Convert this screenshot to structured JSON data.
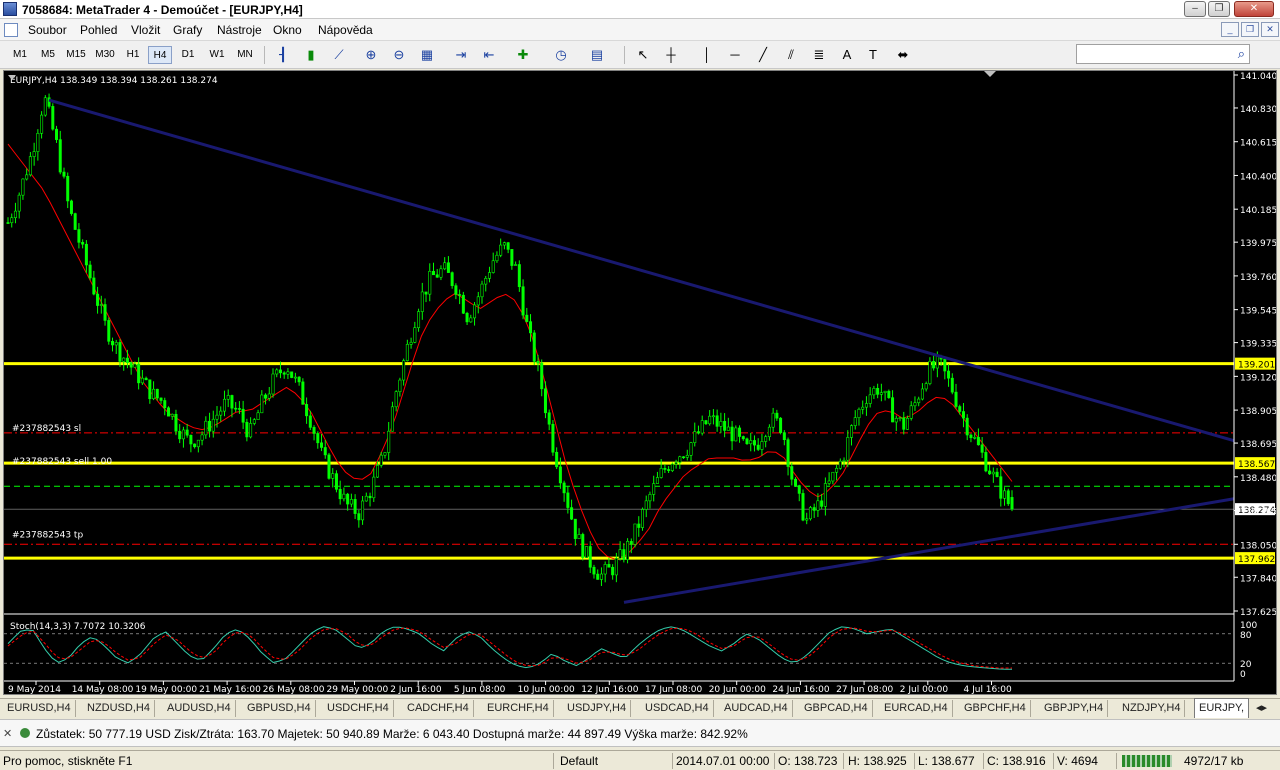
{
  "window": {
    "title": "7058684: MetaTrader 4 - Demoúčet - [EURJPY,H4]"
  },
  "menu": [
    "Soubor",
    "Pohled",
    "Vložit",
    "Grafy",
    "Nástroje",
    "Okno",
    "Nápověda"
  ],
  "toolbar": {
    "timeframes": [
      "M1",
      "M5",
      "M15",
      "M30",
      "H1",
      "H4",
      "D1",
      "W1",
      "MN"
    ],
    "active_timeframe": "H4",
    "search_placeholder": ""
  },
  "chart_header": "EURJPY,H4  138.349 138.394 138.261 138.274",
  "indicator_header": "Stoch(14,3,3) 7.7072 10.3206",
  "order_labels": {
    "sl": "#237882543 sl",
    "sell": "#237882543 sell 1.00",
    "tp": "#237882543 tp"
  },
  "colors": {
    "background": "#000000",
    "candle": "#00ff00",
    "ma": "#ff0000",
    "sr_line": "#ffff00",
    "trendline": "#191970"
  },
  "chart_data": {
    "type": "candlestick",
    "symbol": "EURJPY",
    "timeframe": "H4",
    "ohlc": {
      "open": 138.349,
      "high": 138.394,
      "low": 138.261,
      "close": 138.274
    },
    "y_ticks": [
      "141.040",
      "140.830",
      "140.615",
      "140.400",
      "140.185",
      "139.975",
      "139.760",
      "139.545",
      "139.335",
      "139.120",
      "138.905",
      "138.695",
      "138.480",
      "138.265",
      "138.050",
      "137.840",
      "137.625"
    ],
    "ylim": [
      137.625,
      141.04
    ],
    "x_ticks": [
      "9 May 2014",
      "14 May 08:00",
      "19 May 00:00",
      "21 May 16:00",
      "26 May 08:00",
      "29 May 00:00",
      "2 Jun 16:00",
      "5 Jun 08:00",
      "10 Jun 00:00",
      "12 Jun 16:00",
      "17 Jun 08:00",
      "20 Jun 00:00",
      "24 Jun 16:00",
      "27 Jun 08:00",
      "2 Jul 00:00",
      "4 Jul 16:00"
    ],
    "close_series": [
      140.1,
      140.3,
      140.55,
      140.9,
      140.6,
      140.2,
      139.95,
      139.7,
      139.45,
      139.3,
      139.2,
      139.1,
      139.0,
      138.95,
      138.8,
      138.7,
      138.75,
      138.85,
      138.95,
      138.9,
      138.75,
      138.95,
      139.1,
      139.2,
      139.05,
      138.85,
      138.6,
      138.45,
      138.3,
      138.25,
      138.4,
      138.6,
      139.0,
      139.3,
      139.6,
      139.75,
      139.8,
      139.7,
      139.5,
      139.65,
      139.85,
      139.95,
      139.8,
      139.4,
      139.1,
      138.7,
      138.4,
      138.1,
      137.95,
      137.85,
      137.9,
      138.0,
      138.15,
      138.35,
      138.5,
      138.6,
      138.65,
      138.75,
      138.85,
      138.8,
      138.75,
      138.65,
      138.7,
      138.85,
      138.8,
      138.4,
      138.2,
      138.3,
      138.45,
      138.6,
      138.85,
      139.0,
      139.05,
      138.9,
      138.8,
      138.95,
      139.15,
      139.2,
      139.05,
      138.85,
      138.7,
      138.55,
      138.4,
      138.274
    ],
    "ma_series": [
      140.6,
      140.5,
      140.4,
      140.3,
      140.15,
      140.0,
      139.85,
      139.7,
      139.55,
      139.4,
      139.25,
      139.1,
      139.0,
      138.9,
      138.85,
      138.8,
      138.78,
      138.8,
      138.85,
      138.9,
      138.9,
      138.95,
      139.0,
      139.05,
      139.0,
      138.9,
      138.75,
      138.6,
      138.5,
      138.45,
      138.5,
      138.65,
      138.85,
      139.1,
      139.35,
      139.5,
      139.6,
      139.65,
      139.6,
      139.55,
      139.6,
      139.65,
      139.6,
      139.45,
      139.2,
      138.9,
      138.6,
      138.35,
      138.15,
      138.0,
      137.95,
      137.97,
      138.05,
      138.15,
      138.3,
      138.4,
      138.5,
      138.55,
      138.6,
      138.6,
      138.6,
      138.58,
      138.6,
      138.65,
      138.62,
      138.5,
      138.4,
      138.35,
      138.4,
      138.5,
      138.65,
      138.8,
      138.9,
      138.9,
      138.85,
      138.88,
      138.95,
      139.0,
      138.95,
      138.85,
      138.75,
      138.65,
      138.55,
      138.45
    ],
    "hlines": [
      {
        "price": 139.201,
        "label": "139.201",
        "color": "#ffff00",
        "style": "solid"
      },
      {
        "price": 138.567,
        "label": "138.567",
        "color": "#ffff00",
        "style": "solid"
      },
      {
        "price": 137.962,
        "label": "137.962",
        "color": "#ffff00",
        "style": "solid"
      },
      {
        "price": 138.76,
        "label": "",
        "color": "#ff0000",
        "style": "dashdot"
      },
      {
        "price": 138.42,
        "label": "",
        "color": "#00ff00",
        "style": "dash"
      },
      {
        "price": 138.05,
        "label": "",
        "color": "#ff0000",
        "style": "dashdot"
      },
      {
        "price": 138.274,
        "label": "138.274",
        "color": "#c0c0c0",
        "style": "solid"
      }
    ],
    "stoch": {
      "levels": [
        100,
        80,
        20,
        0
      ],
      "main": [
        60,
        85,
        90,
        50,
        20,
        30,
        60,
        75,
        55,
        30,
        20,
        40,
        70,
        85,
        60,
        35,
        25,
        50,
        80,
        90,
        70,
        40,
        20,
        30,
        55,
        80,
        95,
        90,
        70,
        50,
        60,
        85,
        95,
        90,
        80,
        60,
        45,
        70,
        85,
        75,
        50,
        30,
        15,
        10,
        20,
        40,
        25,
        15,
        30,
        50,
        40,
        30,
        55,
        75,
        90,
        95,
        85,
        70,
        55,
        45,
        60,
        80,
        70,
        50,
        30,
        20,
        35,
        60,
        85,
        95,
        90,
        80,
        85,
        90,
        75,
        60,
        45,
        30,
        20,
        15,
        12,
        10,
        8,
        7.7
      ],
      "signal": [
        55,
        75,
        88,
        62,
        32,
        28,
        48,
        68,
        62,
        40,
        25,
        33,
        58,
        78,
        68,
        45,
        30,
        40,
        68,
        85,
        78,
        52,
        30,
        28,
        45,
        70,
        88,
        92,
        80,
        58,
        55,
        75,
        90,
        92,
        85,
        68,
        52,
        60,
        78,
        80,
        60,
        40,
        22,
        14,
        16,
        32,
        30,
        20,
        25,
        42,
        43,
        35,
        45,
        65,
        82,
        92,
        90,
        78,
        62,
        50,
        55,
        72,
        75,
        58,
        38,
        25,
        30,
        50,
        75,
        90,
        92,
        85,
        84,
        88,
        80,
        66,
        52,
        38,
        26,
        19,
        14,
        12,
        10,
        10.3
      ]
    }
  },
  "tabs": [
    "EURUSD,H4",
    "NZDUSD,H4",
    "AUDUSD,H4",
    "GBPUSD,H4",
    "USDCHF,H4",
    "CADCHF,H4",
    "EURCHF,H4",
    "USDJPY,H4",
    "USDCAD,H4",
    "AUDCAD,H4",
    "GBPCAD,H4",
    "EURCAD,H4",
    "GBPCHF,H4",
    "GBPJPY,H4",
    "NZDJPY,H4",
    "EURJPY,"
  ],
  "account": {
    "text": "Zůstatek: 50 777.19 USD  Zisk/Ztráta: 163.70  Majetek: 50 940.89  Marže: 6 043.40  Dostupná marže: 44 897.49  Výška marže: 842.92%"
  },
  "status": {
    "help": "Pro pomoc, stiskněte F1",
    "profile": "Default",
    "time": "2014.07.01 00:00",
    "open": "O: 138.723",
    "high": "H: 138.925",
    "low": "L: 138.677",
    "close": "C: 138.916",
    "volume": "V: 4694",
    "traffic": "4972/17 kb"
  }
}
